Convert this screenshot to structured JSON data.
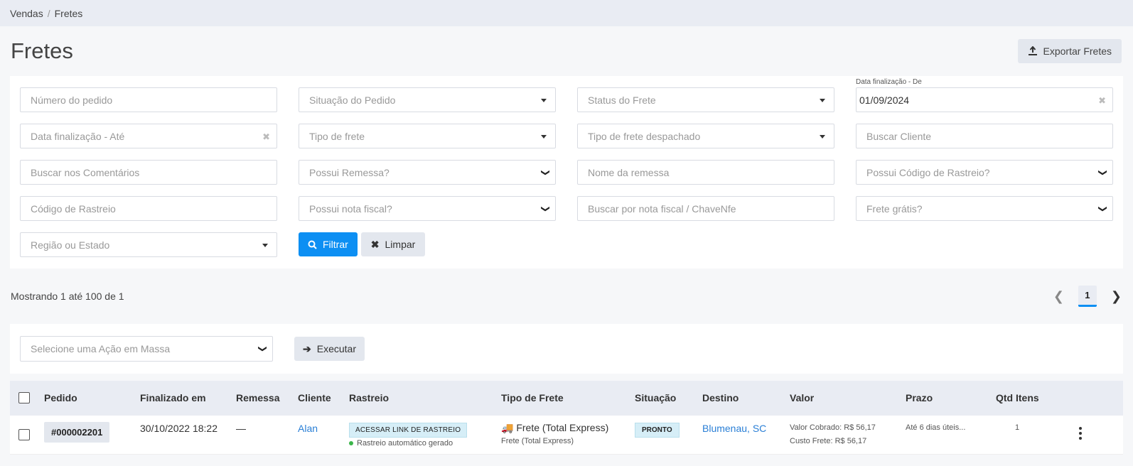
{
  "breadcrumb": {
    "items": [
      "Vendas",
      "Fretes"
    ]
  },
  "page": {
    "title": "Fretes",
    "export_label": "Exportar Fretes"
  },
  "filters": {
    "numero_pedido": "Número do pedido",
    "situacao_pedido": "Situação do Pedido",
    "status_frete": "Status do Frete",
    "data_de_label": "Data finalização - De",
    "data_de_value": "01/09/2024",
    "data_ate": "Data finalização - Até",
    "tipo_frete": "Tipo de frete",
    "tipo_frete_despachado": "Tipo de frete despachado",
    "buscar_cliente": "Buscar Cliente",
    "buscar_comentarios": "Buscar nos Comentários",
    "possui_remessa": "Possui Remessa?",
    "nome_remessa": "Nome da remessa",
    "possui_rastreio": "Possui Código de Rastreio?",
    "codigo_rastreio": "Código de Rastreio",
    "possui_nota": "Possui nota fiscal?",
    "buscar_nota": "Buscar por nota fiscal / ChaveNfe",
    "frete_gratis": "Frete grátis?",
    "regiao": "Região ou Estado",
    "filtrar_label": "Filtrar",
    "limpar_label": "Limpar"
  },
  "listing": {
    "summary": "Mostrando 1 até 100 de 1",
    "current_page": "1"
  },
  "mass_action": {
    "placeholder": "Selecione uma Ação em Massa",
    "execute_label": "Executar"
  },
  "table": {
    "headers": [
      "Pedido",
      "Finalizado em",
      "Remessa",
      "Cliente",
      "Rastreio",
      "Tipo de Frete",
      "Situação",
      "Destino",
      "Valor",
      "Prazo",
      "Qtd Itens"
    ],
    "rows": [
      {
        "pedido": "#000002201",
        "finalizado": "30/10/2022 18:22",
        "remessa": "—",
        "cliente": "Alan",
        "rastreio_badge": "ACESSAR LINK DE RASTREIO",
        "rastreio_status": "Rastreio automático gerado",
        "tipo_frete": "Frete (Total Express)",
        "tipo_frete_sub": "Frete (Total Express)",
        "situacao": "PRONTO",
        "destino": "Blumenau, SC",
        "valor_cobrado": "Valor Cobrado: R$ 56,17",
        "custo_frete": "Custo Frete: R$ 56,17",
        "prazo": "Até 6 dias úteis...",
        "qtd": "1"
      }
    ]
  },
  "icons": {
    "export": "export-icon",
    "search": "search-icon",
    "clear": "close-icon",
    "arrow": "arrow-right-icon",
    "truck": "truck-icon",
    "menu": "kebab-menu-icon"
  },
  "colors": {
    "primary": "#0d8ff3",
    "link": "#2a7fd6",
    "badge": "#d6eef7",
    "status_dot": "#3bb54a"
  }
}
